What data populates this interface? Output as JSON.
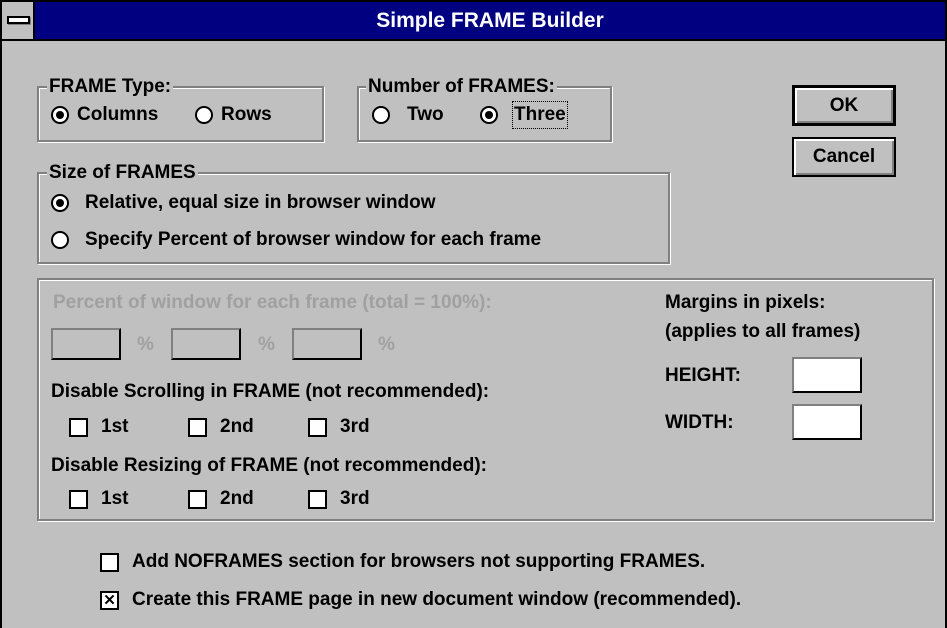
{
  "window": {
    "title": "Simple FRAME Builder"
  },
  "frame_type": {
    "legend": "FRAME Type:",
    "options": [
      "Columns",
      "Rows"
    ],
    "selected": "Columns"
  },
  "num_frames": {
    "legend": "Number of FRAMES:",
    "options": [
      "Two",
      "Three"
    ],
    "selected": "Three"
  },
  "buttons": {
    "ok": "OK",
    "cancel": "Cancel"
  },
  "size": {
    "legend": "Size of FRAMES",
    "options": [
      "Relative, equal size in browser window",
      "Specify Percent of browser window for each frame"
    ],
    "selected": "Relative, equal size in browser window"
  },
  "percent": {
    "label": "Percent of window for each frame (total = 100%):",
    "unit": "%",
    "values": [
      "",
      "",
      ""
    ]
  },
  "margins": {
    "label_line1": "Margins in pixels:",
    "label_line2": "(applies to all frames)",
    "height_label": "HEIGHT:",
    "height_value": "",
    "width_label": "WIDTH:",
    "width_value": ""
  },
  "scrolling": {
    "label": "Disable Scrolling in FRAME (not recommended):",
    "items": [
      {
        "label": "1st",
        "checked": false
      },
      {
        "label": "2nd",
        "checked": false
      },
      {
        "label": "3rd",
        "checked": false
      }
    ]
  },
  "resizing": {
    "label": "Disable Resizing of FRAME (not recommended):",
    "items": [
      {
        "label": "1st",
        "checked": false
      },
      {
        "label": "2nd",
        "checked": false
      },
      {
        "label": "3rd",
        "checked": false
      }
    ]
  },
  "options": {
    "noframes": {
      "label": "Add NOFRAMES section for browsers not supporting FRAMES.",
      "checked": false
    },
    "new_window": {
      "label": "Create this FRAME page in new document window (recommended).",
      "checked": true
    }
  }
}
